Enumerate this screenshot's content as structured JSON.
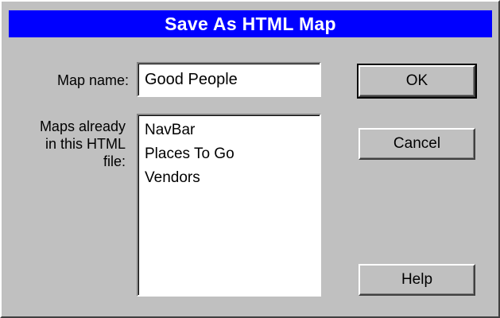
{
  "dialog": {
    "title": "Save As HTML Map"
  },
  "map_name": {
    "label": "Map name:",
    "value": "Good People"
  },
  "existing_maps": {
    "label_lines": [
      "Maps already",
      "in this HTML",
      "file:"
    ],
    "items": [
      "NavBar",
      "Places To Go",
      "Vendors"
    ]
  },
  "buttons": {
    "ok": "OK",
    "cancel": "Cancel",
    "help": "Help"
  },
  "colors": {
    "title_bar": "#0000ff",
    "dialog_bg": "#c0c0c0",
    "field_bg": "#ffffff"
  }
}
